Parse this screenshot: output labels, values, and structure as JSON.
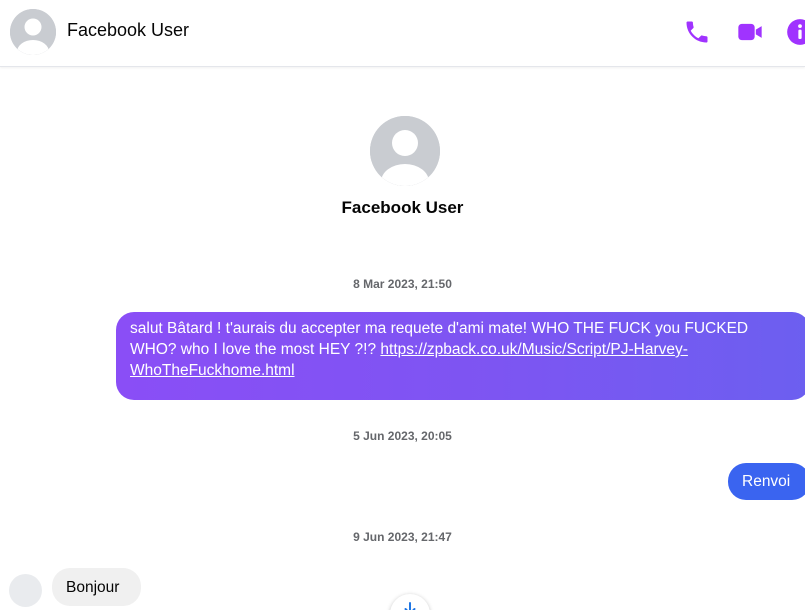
{
  "header": {
    "contact_name": "Facebook User",
    "icons": [
      "avatar",
      "phone-icon",
      "video-icon",
      "info-icon"
    ],
    "accent_color": "#a033ff"
  },
  "profile": {
    "name": "Facebook User"
  },
  "conversation": {
    "timestamps": [
      "8 Mar 2023, 21:50",
      "5 Jun 2023, 20:05",
      "9 Jun 2023, 21:47"
    ],
    "messages": [
      {
        "direction": "outgoing",
        "text": "salut Bâtard ! t'aurais du accepter ma requete d'ami mate! WHO THE FUCK you FUCKED WHO? who I love the most HEY ?!? ",
        "link": "https://zpback.co.uk/Music/Script/PJ-Harvey-WhoTheFuckhome.html",
        "color": "#7d55f2"
      },
      {
        "direction": "outgoing",
        "text": "Renvoi",
        "color": "#3a64f0"
      },
      {
        "direction": "incoming",
        "text": "Bonjour",
        "color": "#f0f0f0"
      }
    ]
  }
}
